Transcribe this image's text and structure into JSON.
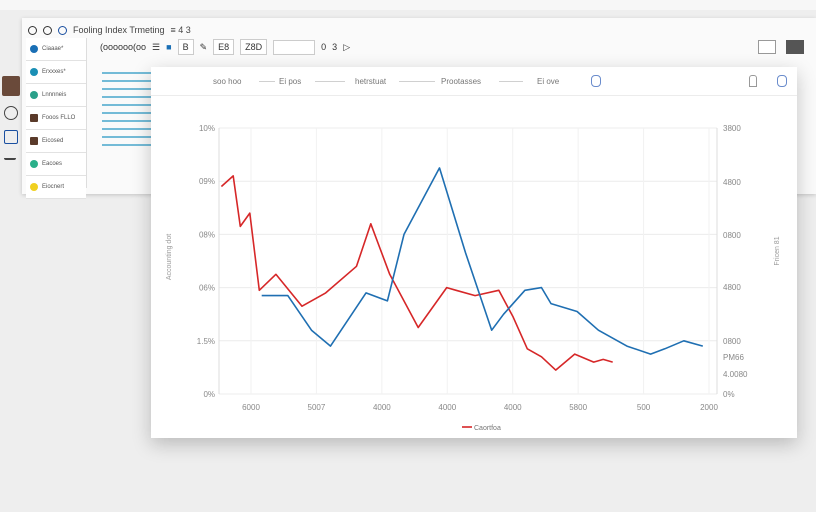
{
  "app": {
    "title": "Fooling Index Trmeting",
    "title_suffix": "≡ 4 3",
    "toolbar": {
      "name_field": "(oooooo(oo",
      "btn1": "B",
      "btn2": "E8",
      "btn3": "Z8D",
      "btn4": "0",
      "btn5": "3"
    }
  },
  "sidebar": {
    "items": [
      {
        "label": "Ciaaae*",
        "color": "#1a6fb5"
      },
      {
        "label": "Erxxxes*",
        "color": "#1a8fb5"
      },
      {
        "label": "Lnnnneis",
        "color": "#2aa08a"
      },
      {
        "label": "Fooos FLLO",
        "color": "#5a3a2a"
      },
      {
        "label": "Eicosed",
        "color": "#5a3a2a"
      },
      {
        "label": "Eacoes",
        "color": "#2ab08a"
      },
      {
        "label": "Eiocnert",
        "color": "#f0d020"
      }
    ]
  },
  "panel": {
    "tabs": [
      "soo hoo",
      "Ei pos",
      "hetrstuat",
      "Prootasses",
      "Ei ove"
    ]
  },
  "chart_data": {
    "type": "line",
    "x": [
      1,
      2,
      3,
      4,
      5,
      6,
      7,
      8
    ],
    "x_tick_labels": [
      "6000",
      "5007",
      "4000",
      "4000",
      "4000",
      "5800",
      "500",
      "2000"
    ],
    "y_left_tick_labels": [
      "10%",
      "09%",
      "08%",
      "06%",
      "1.5%",
      "0%"
    ],
    "y_right_tick_labels": [
      "3800",
      "4800",
      "0800",
      "4800",
      "0800",
      "PM66",
      "4.0080",
      "0%"
    ],
    "ylim": [
      0,
      100
    ],
    "ylabel": "Accounting dot",
    "y2label": "Fricen 81",
    "series": [
      {
        "name": "Caortfoa",
        "color": "#d62728",
        "points": [
          [
            1.05,
            78
          ],
          [
            1.3,
            82
          ],
          [
            1.45,
            63
          ],
          [
            1.65,
            68
          ],
          [
            1.85,
            39
          ],
          [
            2.2,
            45
          ],
          [
            2.75,
            33
          ],
          [
            3.25,
            38
          ],
          [
            3.9,
            48
          ],
          [
            4.2,
            64
          ],
          [
            4.6,
            45
          ],
          [
            5.2,
            25
          ],
          [
            5.8,
            40
          ],
          [
            6.0,
            39
          ],
          [
            6.4,
            37
          ],
          [
            6.9,
            39
          ],
          [
            7.2,
            29
          ],
          [
            7.5,
            17
          ],
          [
            7.8,
            14
          ],
          [
            8.1,
            9
          ],
          [
            8.5,
            15
          ],
          [
            8.9,
            12
          ],
          [
            9.1,
            13
          ],
          [
            9.3,
            12
          ]
        ]
      },
      {
        "name": "",
        "color": "#1f6fb2",
        "points": [
          [
            1.9,
            37
          ],
          [
            2.45,
            37
          ],
          [
            2.95,
            24
          ],
          [
            3.35,
            18
          ],
          [
            3.8,
            30
          ],
          [
            4.1,
            38
          ],
          [
            4.55,
            35
          ],
          [
            4.9,
            60
          ],
          [
            5.65,
            85
          ],
          [
            6.2,
            53
          ],
          [
            6.75,
            24
          ],
          [
            7.0,
            30
          ],
          [
            7.45,
            39
          ],
          [
            7.8,
            40
          ],
          [
            8.0,
            34
          ],
          [
            8.55,
            31
          ],
          [
            9.0,
            24
          ],
          [
            9.6,
            18
          ],
          [
            10.1,
            15
          ],
          [
            10.4,
            17
          ],
          [
            10.8,
            20
          ],
          [
            11.2,
            18
          ]
        ]
      }
    ],
    "legend": "bottom-center",
    "grid": true
  }
}
